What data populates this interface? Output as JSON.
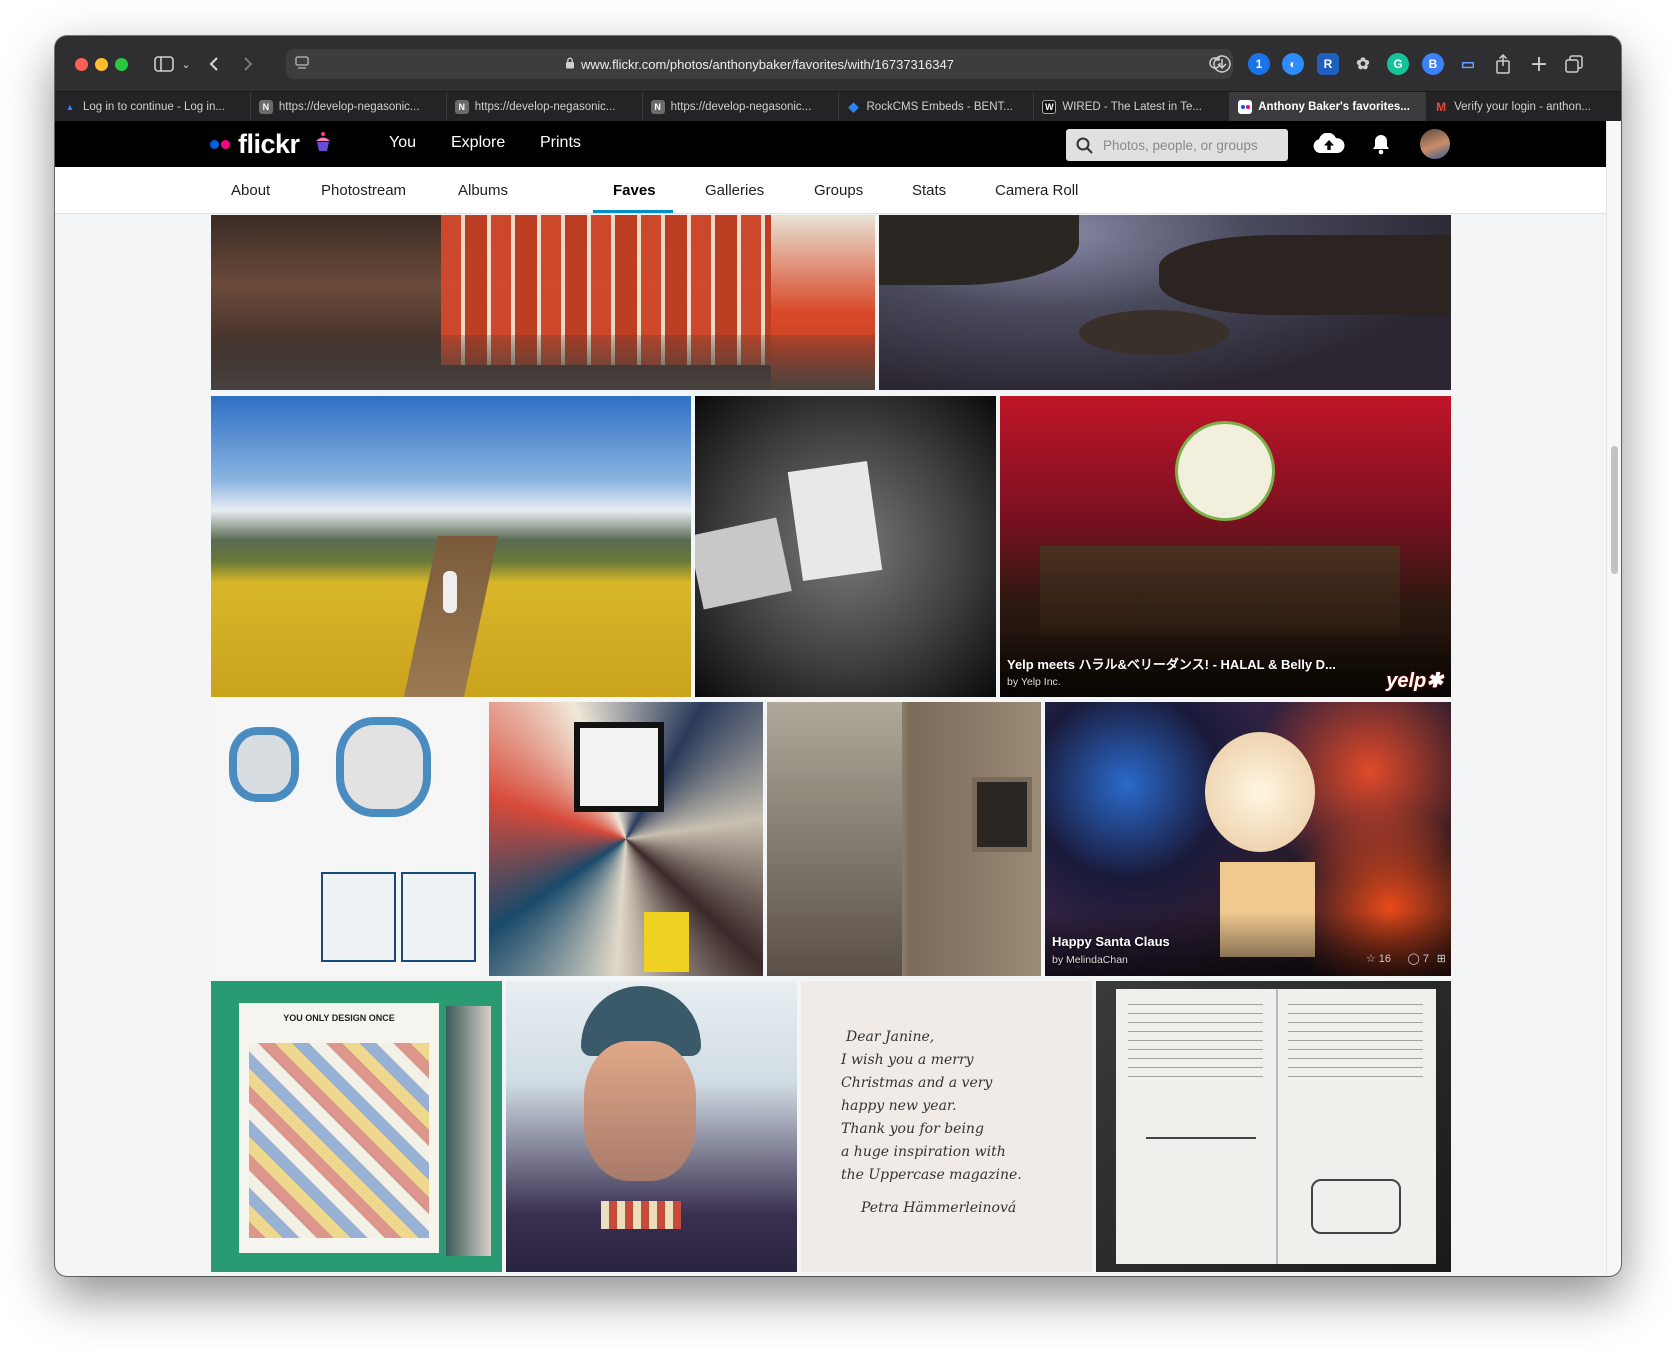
{
  "browser": {
    "url": "www.flickr.com/photos/anthonybaker/favorites/with/16737316347",
    "tabs": [
      {
        "title": "Log in to continue - Log in...",
        "icon": "atlassian-icon",
        "color": "#2684ff"
      },
      {
        "title": "https://develop-negasonic...",
        "icon": "notion-icon",
        "color": "#6b6b6b"
      },
      {
        "title": "https://develop-negasonic...",
        "icon": "notion-icon",
        "color": "#6b6b6b"
      },
      {
        "title": "https://develop-negasonic...",
        "icon": "notion-icon",
        "color": "#6b6b6b"
      },
      {
        "title": "RockCMS Embeds - BENT...",
        "icon": "jira-icon",
        "color": "#2684ff"
      },
      {
        "title": "WIRED - The Latest in Te...",
        "icon": "wired-icon",
        "color": "#111111"
      },
      {
        "title": "Anthony Baker's favorites...",
        "icon": "flickr-icon",
        "color": "#ffffff"
      },
      {
        "title": "Verify your login - anthon...",
        "icon": "gmail-icon",
        "color": "#ea4335"
      }
    ],
    "active_tab": 6
  },
  "flickr": {
    "logo": "flickr",
    "nav": {
      "you": "You",
      "explore": "Explore",
      "prints": "Prints"
    },
    "search_placeholder": "Photos, people, or groups",
    "colors": {
      "blue_dot": "#0063dc",
      "pink_dot": "#ff0084",
      "accent": "#008ecd"
    }
  },
  "subnav": {
    "tabs": [
      "About",
      "Photostream",
      "Albums",
      "Faves",
      "Galleries",
      "Groups",
      "Stats",
      "Camera Roll"
    ],
    "active": "Faves"
  },
  "photos": {
    "yelp": {
      "title": "Yelp meets ハラル&ベリーダンス! - HALAL & Belly D...",
      "by": "by Yelp Inc."
    },
    "santa": {
      "title": "Happy Santa Claus",
      "by": "by MelindaChan",
      "faves": "16",
      "comments": "7"
    },
    "magazine": {
      "headline": "YOU ONLY DESIGN ONCE"
    },
    "letter": {
      "lines": [
        "Dear Janine,",
        "I wish you a merry",
        "Christmas and a very",
        "happy new year.",
        "Thank you for being",
        "a huge inspiration with",
        "the Uppercase magazine.",
        "Petra Hämmerleinová"
      ]
    }
  }
}
